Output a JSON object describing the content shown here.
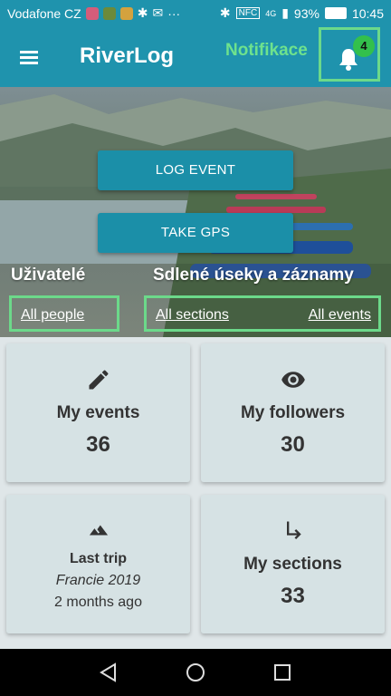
{
  "status": {
    "carrier": "Vodafone CZ",
    "net": "4G",
    "battery": "93%",
    "time": "10:45"
  },
  "app": {
    "title": "RiverLog",
    "notif_label": "Notifikace",
    "notif_count": "4"
  },
  "hero": {
    "log_event": "LOG EVENT",
    "take_gps": "TAKE GPS",
    "users_heading": "Uživatelé",
    "shared_heading": "Sdlené úseky a záznamy",
    "all_people": "All people",
    "all_sections": "All sections",
    "all_events": "All events"
  },
  "cards": {
    "my_events": {
      "title": "My events",
      "value": "36",
      "icon": "pencil-icon"
    },
    "my_followers": {
      "title": "My followers",
      "value": "30",
      "icon": "eye-icon"
    },
    "last_trip": {
      "title": "Last trip",
      "trip": "Francie 2019",
      "when": "2 months ago",
      "icon": "mountain-icon"
    },
    "my_sections": {
      "title": "My sections",
      "value": "33",
      "icon": "turn-arrow-icon"
    }
  },
  "colors": {
    "primary": "#1f93ad",
    "highlight": "#6cd98a",
    "badge": "#33c04c"
  }
}
